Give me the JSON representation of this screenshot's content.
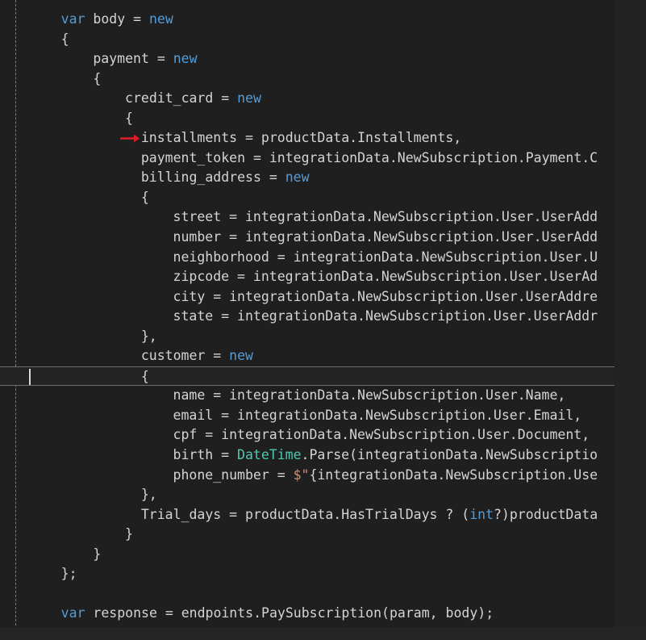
{
  "editor": {
    "app": "code-editor",
    "language": "csharp",
    "background_color": "#1f1f1f",
    "default_text_color": "#d4d4d4",
    "keyword_color": "#569cd6",
    "type_color": "#4ec9b0",
    "string_color": "#ce9178",
    "current_line_background": "#232323",
    "current_line_border_color": "#6e6e6e",
    "marker_color": "#e01b24",
    "caret_color": "#d8d8d8",
    "fold_guide_color": "#8a8a8a"
  },
  "markers": {
    "step_arrow_line_index": 5,
    "step_arrow_name": "debug-step-arrow",
    "caret_line_index": 18,
    "current_line_index": 18
  },
  "code": {
    "lines": [
      {
        "indent": 2,
        "marker": false,
        "tokens": [
          {
            "t": "var",
            "c": "kw"
          },
          {
            "t": " body ",
            "c": "ident"
          },
          {
            "t": "= ",
            "c": "punct"
          },
          {
            "t": "new",
            "c": "kw"
          }
        ]
      },
      {
        "indent": 2,
        "marker": false,
        "tokens": [
          {
            "t": "{",
            "c": "brace"
          }
        ]
      },
      {
        "indent": 4,
        "marker": false,
        "tokens": [
          {
            "t": "payment ",
            "c": "ident"
          },
          {
            "t": "= ",
            "c": "punct"
          },
          {
            "t": "new",
            "c": "kw"
          }
        ]
      },
      {
        "indent": 4,
        "marker": false,
        "tokens": [
          {
            "t": "{",
            "c": "brace"
          }
        ]
      },
      {
        "indent": 6,
        "marker": false,
        "tokens": [
          {
            "t": "credit_card ",
            "c": "ident"
          },
          {
            "t": "= ",
            "c": "punct"
          },
          {
            "t": "new",
            "c": "kw"
          }
        ]
      },
      {
        "indent": 6,
        "marker": false,
        "tokens": [
          {
            "t": "{",
            "c": "brace"
          }
        ]
      },
      {
        "indent": 7,
        "marker": true,
        "tokens": [
          {
            "t": "installments ",
            "c": "ident"
          },
          {
            "t": "= ",
            "c": "punct"
          },
          {
            "t": "productData.Installments,",
            "c": "prop"
          }
        ]
      },
      {
        "indent": 7,
        "marker": false,
        "tokens": [
          {
            "t": "payment_token ",
            "c": "ident"
          },
          {
            "t": "= ",
            "c": "punct"
          },
          {
            "t": "integrationData.NewSubscription.Payment.C",
            "c": "prop"
          }
        ]
      },
      {
        "indent": 7,
        "marker": false,
        "tokens": [
          {
            "t": "billing_address ",
            "c": "ident"
          },
          {
            "t": "= ",
            "c": "punct"
          },
          {
            "t": "new",
            "c": "kw"
          }
        ]
      },
      {
        "indent": 7,
        "marker": false,
        "tokens": [
          {
            "t": "{",
            "c": "brace"
          }
        ]
      },
      {
        "indent": 9,
        "marker": false,
        "tokens": [
          {
            "t": "street ",
            "c": "ident"
          },
          {
            "t": "= ",
            "c": "punct"
          },
          {
            "t": "integrationData.NewSubscription.User.UserAdd",
            "c": "prop"
          }
        ]
      },
      {
        "indent": 9,
        "marker": false,
        "tokens": [
          {
            "t": "number ",
            "c": "ident"
          },
          {
            "t": "= ",
            "c": "punct"
          },
          {
            "t": "integrationData.NewSubscription.User.UserAdd",
            "c": "prop"
          }
        ]
      },
      {
        "indent": 9,
        "marker": false,
        "tokens": [
          {
            "t": "neighborhood ",
            "c": "ident"
          },
          {
            "t": "= ",
            "c": "punct"
          },
          {
            "t": "integrationData.NewSubscription.User.U",
            "c": "prop"
          }
        ]
      },
      {
        "indent": 9,
        "marker": false,
        "tokens": [
          {
            "t": "zipcode ",
            "c": "ident"
          },
          {
            "t": "= ",
            "c": "punct"
          },
          {
            "t": "integrationData.NewSubscription.User.UserAd",
            "c": "prop"
          }
        ]
      },
      {
        "indent": 9,
        "marker": false,
        "tokens": [
          {
            "t": "city ",
            "c": "ident"
          },
          {
            "t": "= ",
            "c": "punct"
          },
          {
            "t": "integrationData.NewSubscription.User.UserAddre",
            "c": "prop"
          }
        ]
      },
      {
        "indent": 9,
        "marker": false,
        "tokens": [
          {
            "t": "state ",
            "c": "ident"
          },
          {
            "t": "= ",
            "c": "punct"
          },
          {
            "t": "integrationData.NewSubscription.User.UserAddr",
            "c": "prop"
          }
        ]
      },
      {
        "indent": 7,
        "marker": false,
        "tokens": [
          {
            "t": "},",
            "c": "brace"
          }
        ]
      },
      {
        "indent": 7,
        "marker": false,
        "tokens": [
          {
            "t": "customer ",
            "c": "ident"
          },
          {
            "t": "= ",
            "c": "punct"
          },
          {
            "t": "new",
            "c": "kw"
          }
        ]
      },
      {
        "indent": 7,
        "marker": false,
        "tokens": [
          {
            "t": "{",
            "c": "brace"
          }
        ]
      },
      {
        "indent": 9,
        "marker": false,
        "tokens": [
          {
            "t": "name ",
            "c": "ident"
          },
          {
            "t": "= ",
            "c": "punct"
          },
          {
            "t": "integrationData.NewSubscription.User.Name,",
            "c": "prop"
          }
        ]
      },
      {
        "indent": 9,
        "marker": false,
        "tokens": [
          {
            "t": "email ",
            "c": "ident"
          },
          {
            "t": "= ",
            "c": "punct"
          },
          {
            "t": "integrationData.NewSubscription.User.Email,",
            "c": "prop"
          }
        ]
      },
      {
        "indent": 9,
        "marker": false,
        "tokens": [
          {
            "t": "cpf ",
            "c": "ident"
          },
          {
            "t": "= ",
            "c": "punct"
          },
          {
            "t": "integrationData.NewSubscription.User.Document,",
            "c": "prop"
          }
        ]
      },
      {
        "indent": 9,
        "marker": false,
        "tokens": [
          {
            "t": "birth ",
            "c": "ident"
          },
          {
            "t": "= ",
            "c": "punct"
          },
          {
            "t": "DateTime",
            "c": "type"
          },
          {
            "t": ".Parse(integrationData.NewSubscriptio",
            "c": "prop"
          }
        ]
      },
      {
        "indent": 9,
        "marker": false,
        "tokens": [
          {
            "t": "phone_number ",
            "c": "ident"
          },
          {
            "t": "= ",
            "c": "punct"
          },
          {
            "t": "$\"",
            "c": "str"
          },
          {
            "t": "{integrationData.NewSubscription.Use",
            "c": "prop"
          }
        ]
      },
      {
        "indent": 7,
        "marker": false,
        "tokens": [
          {
            "t": "},",
            "c": "brace"
          }
        ]
      },
      {
        "indent": 7,
        "marker": false,
        "tokens": [
          {
            "t": "Trial_days ",
            "c": "ident"
          },
          {
            "t": "= ",
            "c": "punct"
          },
          {
            "t": "productData.HasTrialDays ? (",
            "c": "prop"
          },
          {
            "t": "int",
            "c": "kw"
          },
          {
            "t": "?)productData",
            "c": "prop"
          }
        ]
      },
      {
        "indent": 6,
        "marker": false,
        "tokens": [
          {
            "t": "}",
            "c": "brace"
          }
        ]
      },
      {
        "indent": 4,
        "marker": false,
        "tokens": [
          {
            "t": "}",
            "c": "brace"
          }
        ]
      },
      {
        "indent": 2,
        "marker": false,
        "tokens": [
          {
            "t": "};",
            "c": "brace"
          }
        ]
      },
      {
        "indent": 0,
        "marker": false,
        "tokens": []
      },
      {
        "indent": 2,
        "marker": false,
        "tokens": [
          {
            "t": "var",
            "c": "kw"
          },
          {
            "t": " response ",
            "c": "ident"
          },
          {
            "t": "= ",
            "c": "punct"
          },
          {
            "t": "endpoints.PaySubscription(param, body);",
            "c": "prop"
          }
        ]
      }
    ]
  }
}
